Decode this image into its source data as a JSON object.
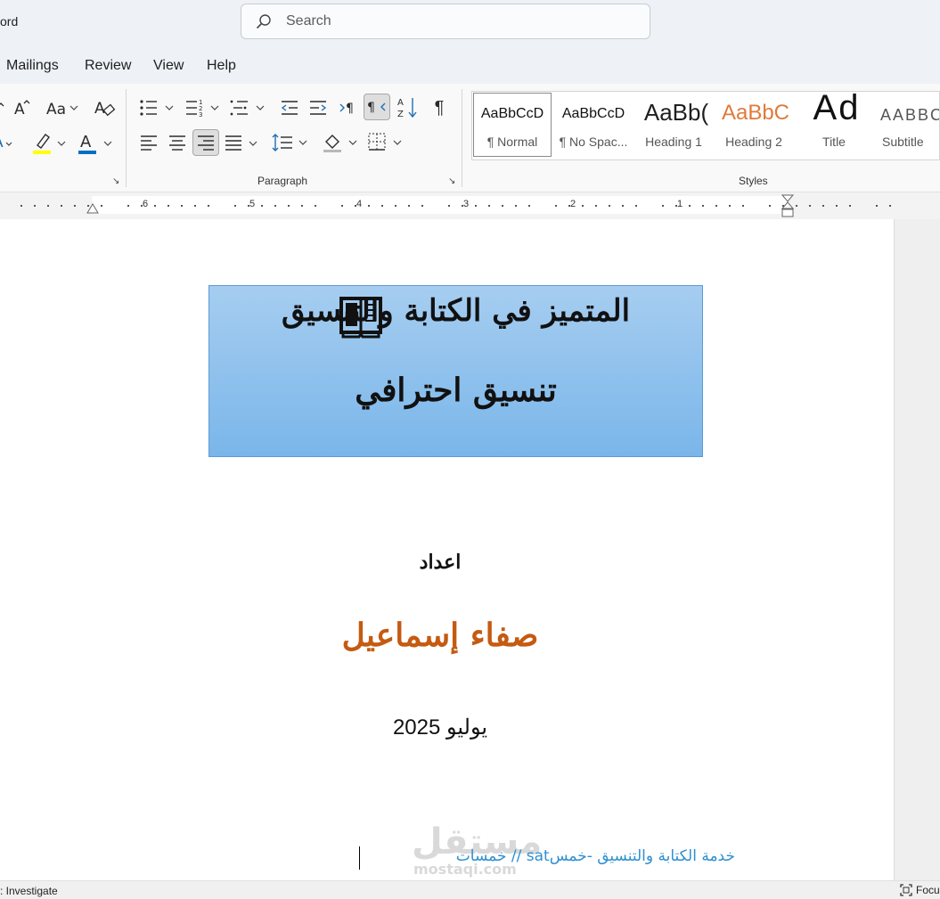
{
  "titlebar": {
    "app_name": "ord",
    "search_placeholder": "Search"
  },
  "menu": {
    "items": [
      "Mailings",
      "Review",
      "View",
      "Help"
    ]
  },
  "ribbon": {
    "groups": {
      "paragraph": "Paragraph",
      "styles": "Styles"
    },
    "highlight_color": "#ffff00",
    "font_color": "#0070c0",
    "styles": [
      {
        "preview": "AaBbCcD",
        "name": "¶ Normal"
      },
      {
        "preview": "AaBbCcD",
        "name": "¶ No Spac..."
      },
      {
        "preview": "AaBb(",
        "name": "Heading 1"
      },
      {
        "preview": "AaBbC",
        "name": "Heading 2"
      },
      {
        "preview": "Ad",
        "name": "Title"
      },
      {
        "preview": "AABBC",
        "name": "Subtitle"
      }
    ]
  },
  "ruler": {
    "numbers": [
      "6",
      "5",
      "4",
      "3",
      "2",
      "1"
    ]
  },
  "document": {
    "title_line1": "المتميز في الكتابة والتنسيق",
    "title_line2": "تنسيق احترافي",
    "title_box_color": "#9dc7ef",
    "prepared_by_label": "اعداد",
    "author_name": "صفاء إسماعيل",
    "author_color": "#c55a11",
    "date": "يوليو 2025",
    "footer_link": "خدمة الكتابة والتنسيق -خمسsat // خمسات",
    "watermark_arabic": "مستقل",
    "watermark_latin": "mostaqi.com"
  },
  "statusbar": {
    "left_text": ": Investigate",
    "right_text": "Focu"
  }
}
